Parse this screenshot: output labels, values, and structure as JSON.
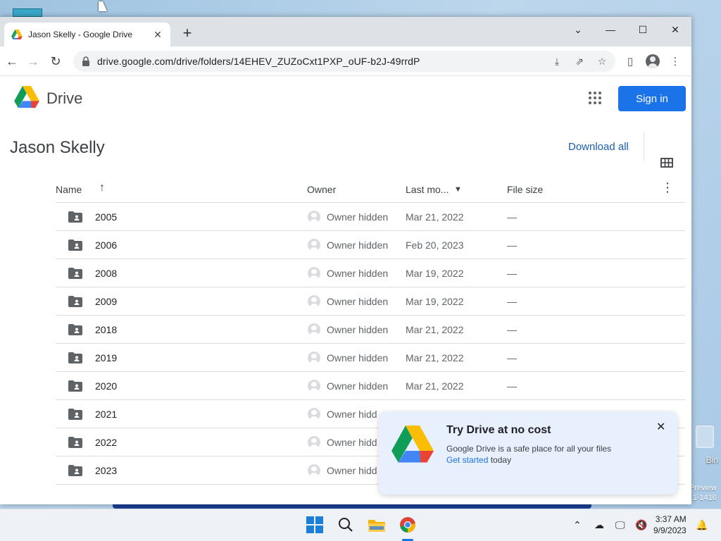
{
  "browser": {
    "tab_title": "Jason Skelly - Google Drive",
    "url": "drive.google.com/drive/folders/14EHEV_ZUZoCxt1PXP_oUF-b2J-49rrdP"
  },
  "drive": {
    "brand": "Drive",
    "signin_label": "Sign in",
    "folder_title": "Jason Skelly",
    "download_all": "Download all"
  },
  "table": {
    "headers": {
      "name": "Name",
      "owner": "Owner",
      "modified": "Last mo...",
      "size": "File size"
    },
    "rows": [
      {
        "name": "2005",
        "owner": "Owner hidden",
        "modified": "Mar 21, 2022",
        "size": "—"
      },
      {
        "name": "2006",
        "owner": "Owner hidden",
        "modified": "Feb 20, 2023",
        "size": "—"
      },
      {
        "name": "2008",
        "owner": "Owner hidden",
        "modified": "Mar 19, 2022",
        "size": "—"
      },
      {
        "name": "2009",
        "owner": "Owner hidden",
        "modified": "Mar 19, 2022",
        "size": "—"
      },
      {
        "name": "2018",
        "owner": "Owner hidden",
        "modified": "Mar 21, 2022",
        "size": "—"
      },
      {
        "name": "2019",
        "owner": "Owner hidden",
        "modified": "Mar 21, 2022",
        "size": "—"
      },
      {
        "name": "2020",
        "owner": "Owner hidden",
        "modified": "Mar 21, 2022",
        "size": "—"
      },
      {
        "name": "2021",
        "owner": "Owner hidd",
        "modified": "",
        "size": ""
      },
      {
        "name": "2022",
        "owner": "Owner hidd",
        "modified": "",
        "size": ""
      },
      {
        "name": "2023",
        "owner": "Owner hidd",
        "modified": "",
        "size": ""
      }
    ]
  },
  "promo": {
    "title": "Try Drive at no cost",
    "text": "Google Drive is a safe place for all your files",
    "link": "Get started",
    "link_suffix": " today"
  },
  "desktop": {
    "bin_label": "Bin",
    "watermark_line1": "Preview",
    "watermark_line2": "1-1416"
  },
  "taskbar": {
    "time": "3:37 AM",
    "date": "9/9/2023"
  },
  "colors": {
    "accent": "#1a73e8",
    "promo_bg": "#e8f0fe"
  }
}
